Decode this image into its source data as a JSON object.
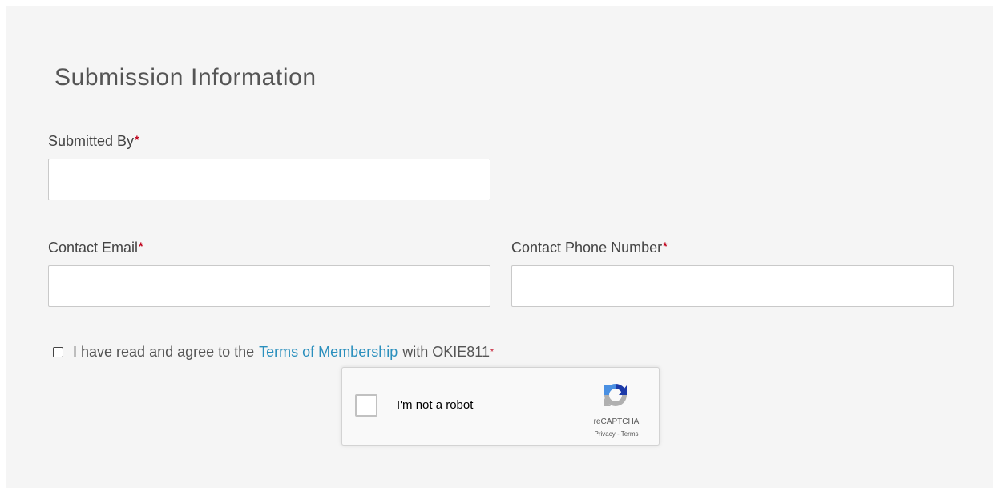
{
  "section": {
    "title": "Submission Information"
  },
  "fields": {
    "submitted_by": {
      "label": "Submitted By",
      "required_mark": "*",
      "value": ""
    },
    "contact_email": {
      "label": "Contact Email",
      "required_mark": "*",
      "value": ""
    },
    "contact_phone": {
      "label": "Contact Phone Number",
      "required_mark": "*",
      "value": ""
    }
  },
  "agreement": {
    "checked": false,
    "prefix": "I have read and agree to the",
    "link_text": "Terms of Membership",
    "suffix": "with OKIE811",
    "required_mark": "*"
  },
  "recaptcha": {
    "label": "I'm not a robot",
    "brand": "reCAPTCHA",
    "privacy": "Privacy",
    "separator": " - ",
    "terms": "Terms",
    "checked": false
  },
  "colors": {
    "panel_background": "#f5f5f5",
    "required": "#c0001a",
    "link": "#2a8fbd",
    "recaptcha_blue": "#4a90e2",
    "recaptcha_dark_blue": "#1c3aa9",
    "recaptcha_grey": "#b0b0b0"
  },
  "icons": {
    "recaptcha_logo": "recaptcha-logo-icon",
    "agree_checkbox": "checkbox-icon"
  }
}
